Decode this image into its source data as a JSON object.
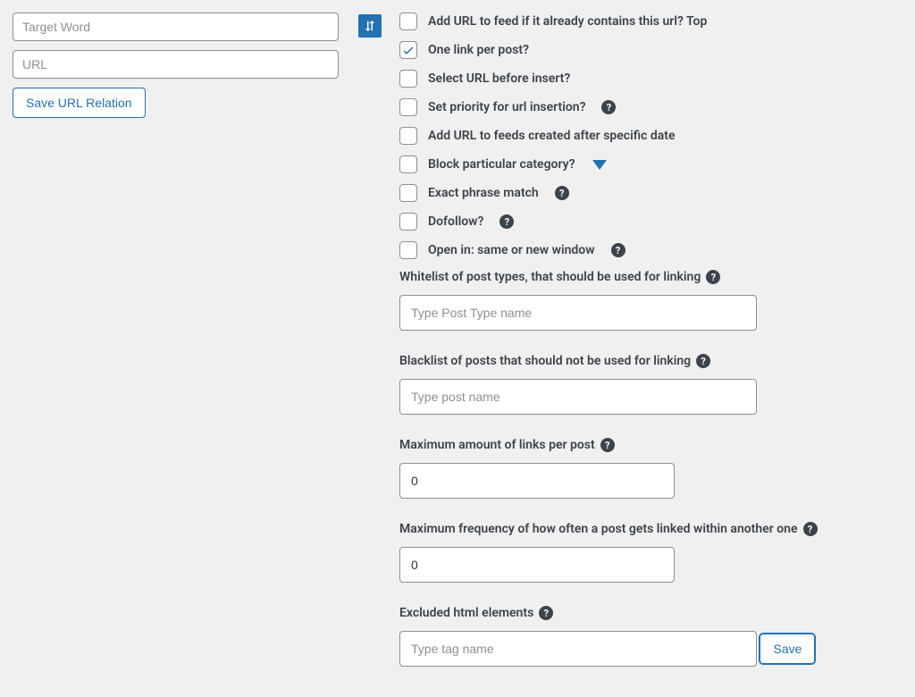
{
  "left": {
    "target_word_placeholder": "Target Word",
    "url_placeholder": "URL",
    "save_relation_label": "Save URL Relation"
  },
  "options": [
    {
      "label": "Add URL to feed if it already contains this url? Top",
      "checked": false,
      "help": false,
      "expand": false
    },
    {
      "label": "One link per post?",
      "checked": true,
      "help": false,
      "expand": false
    },
    {
      "label": "Select URL before insert?",
      "checked": false,
      "help": false,
      "expand": false
    },
    {
      "label": "Set priority for url insertion?",
      "checked": false,
      "help": true,
      "expand": false
    },
    {
      "label": "Add URL to feeds created after specific date",
      "checked": false,
      "help": false,
      "expand": false
    },
    {
      "label": "Block particular category?",
      "checked": false,
      "help": false,
      "expand": true
    },
    {
      "label": "Exact phrase match",
      "checked": false,
      "help": true,
      "expand": false
    },
    {
      "label": "Dofollow?",
      "checked": false,
      "help": true,
      "expand": false
    },
    {
      "label": "Open in: same or new window",
      "checked": false,
      "help": true,
      "expand": false
    }
  ],
  "fields": {
    "whitelist_label": "Whitelist of post types, that should be used for linking",
    "whitelist_placeholder": "Type Post Type name",
    "blacklist_label": "Blacklist of posts that should not be used for linking",
    "blacklist_placeholder": "Type post name",
    "max_links_label": "Maximum amount of links per post",
    "max_links_value": "0",
    "max_freq_label": "Maximum frequency of how often a post gets linked within another one",
    "max_freq_value": "0",
    "excluded_label": "Excluded html elements",
    "excluded_placeholder": "Type tag name"
  },
  "save_label": "Save"
}
